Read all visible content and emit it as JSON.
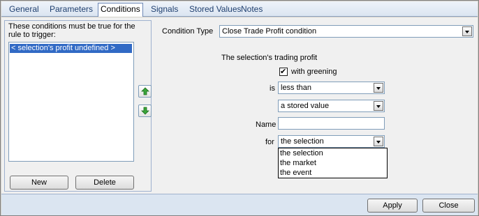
{
  "tabs": [
    {
      "label": "General"
    },
    {
      "label": "Parameters"
    },
    {
      "label": "Conditions"
    },
    {
      "label": "Signals"
    },
    {
      "label": "Stored Values"
    },
    {
      "label": "Notes"
    }
  ],
  "left_panel": {
    "title": "These conditions must be true for the rule to trigger:",
    "conditions": [
      "< selection's profit undefined >"
    ],
    "new_label": "New",
    "delete_label": "Delete"
  },
  "right_panel": {
    "condition_type_label": "Condition Type",
    "condition_type_value": "Close Trade Profit condition",
    "heading": "The selection's trading profit",
    "with_greening_label": "with greening",
    "with_greening_checked": true,
    "is_label": "is",
    "is_value": "less than",
    "compare_value": "a stored value",
    "name_label": "Name",
    "name_value": "",
    "for_label": "for",
    "for_value": "the selection",
    "for_options": [
      "the selection",
      "the market",
      "the event"
    ]
  },
  "footer": {
    "apply_label": "Apply",
    "close_label": "Close"
  }
}
